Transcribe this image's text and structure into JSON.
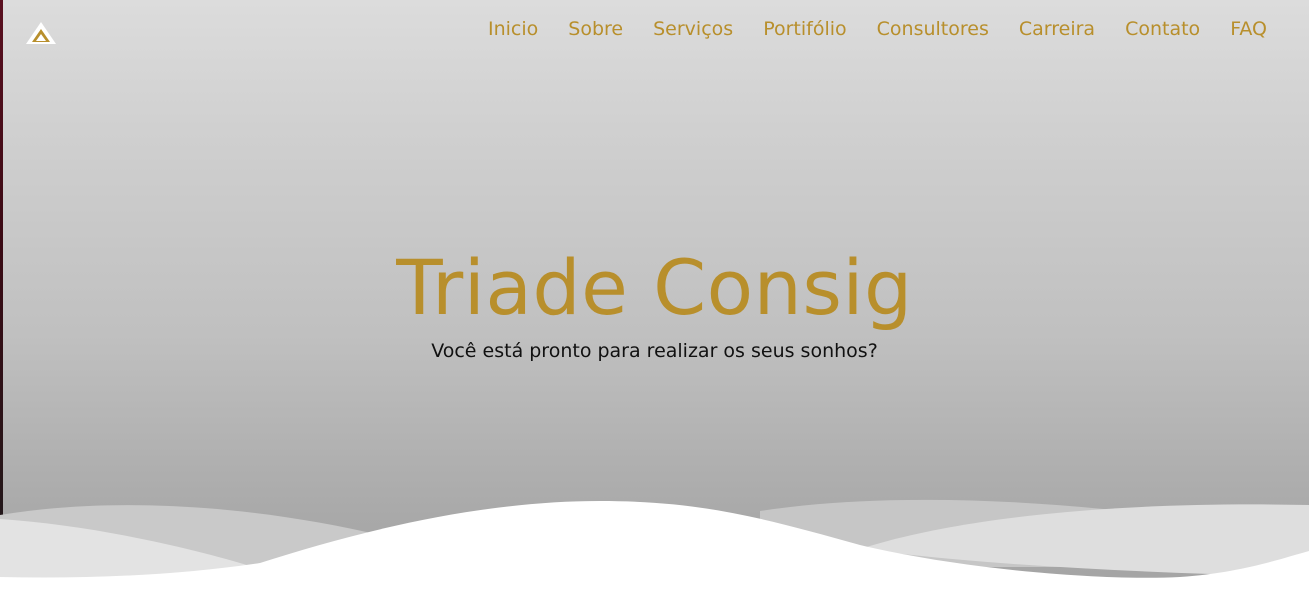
{
  "brand": {
    "logo_icon": "triangle-logo-icon",
    "accent_color": "#b88f2c"
  },
  "nav": {
    "items": [
      {
        "label": "Inicio"
      },
      {
        "label": "Sobre"
      },
      {
        "label": "Serviços"
      },
      {
        "label": "Portifólio"
      },
      {
        "label": "Consultores"
      },
      {
        "label": "Carreira"
      },
      {
        "label": "Contato"
      },
      {
        "label": "FAQ"
      }
    ]
  },
  "hero": {
    "title": "Triade Consig",
    "subtitle": "Você está pronto para realizar os seus sonhos?"
  }
}
